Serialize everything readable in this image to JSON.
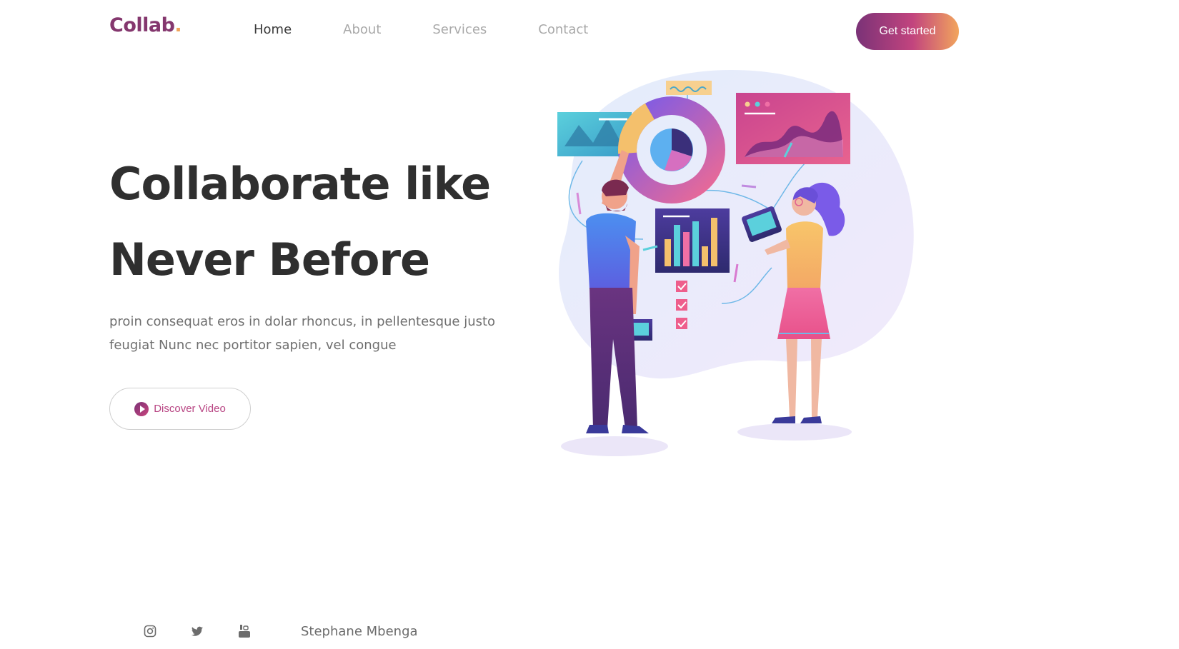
{
  "brand": {
    "logo_text": "Collab",
    "logo_dot": ".",
    "logo_color": "#84376e",
    "dot_color": "#f0a45a"
  },
  "nav": {
    "links": [
      "Home",
      "About",
      "Services",
      "Contact"
    ],
    "active": "Home",
    "cta_label": "Get started"
  },
  "hero": {
    "title_line1": "Collaborate like",
    "title_line2": "Never Before",
    "description": "proin consequat eros in dolar rhoncus, in pellentesque justo feugiat Nunc nec portitor sapien, vel congue",
    "video_button_label": "Discover Video",
    "illustration_icon": "team-dashboard-illustration"
  },
  "footer": {
    "social_icons": [
      "instagram-icon",
      "twitter-icon",
      "youtube-icon"
    ],
    "author": "Stephane Mbenga"
  },
  "colors": {
    "accent_start": "#7a3277",
    "accent_mid": "#c2447e",
    "accent_end": "#f2a55c",
    "heading": "#2f2f2f",
    "body_text": "#6f6f6f",
    "nav_inactive": "#a9a9a9"
  }
}
